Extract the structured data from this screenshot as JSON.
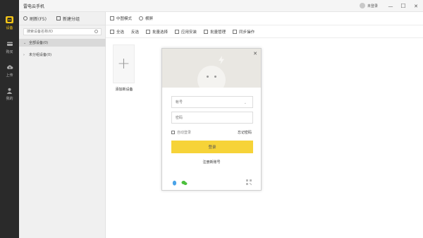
{
  "app": {
    "title": "雷电云手机"
  },
  "account": {
    "status": "未登录"
  },
  "window_controls": {
    "minimize": "—",
    "maximize": "☐",
    "close": "✕"
  },
  "rail": [
    {
      "label": "设备",
      "icon": "device-icon",
      "active": true
    },
    {
      "label": "购买",
      "icon": "cart-icon",
      "active": false
    },
    {
      "label": "上传",
      "icon": "cloud-upload-icon",
      "active": false
    },
    {
      "label": "我的",
      "icon": "user-icon",
      "active": false
    }
  ],
  "groups_toolbar": {
    "refresh": "刷新(F5)",
    "new_group": "新建分组"
  },
  "search": {
    "placeholder": "搜索设备名称/ID"
  },
  "groups": [
    {
      "label": "全部设备(0)",
      "caret": "⌄",
      "selected": true
    },
    {
      "label": "未分组设备(0)",
      "caret": "›",
      "selected": false
    }
  ],
  "view_bar": {
    "mode": "中图模式",
    "orientation": "横屏"
  },
  "action_bar": {
    "select_all": "全选",
    "invert": "反选",
    "batch_select": "批量选择",
    "install_app": "应用安装",
    "batch_manage": "批量管理",
    "sync_ops": "同步操作"
  },
  "add_device": {
    "plus": "+",
    "label": "添加新设备"
  },
  "login_dialog": {
    "close": "✕",
    "account_placeholder": "帐号",
    "password_placeholder": "密码",
    "auto_login": "自动登录",
    "forgot_password": "忘记密码",
    "login_button": "登录",
    "register": "注册新账号"
  },
  "colors": {
    "accent": "#f5c518",
    "button": "#f6d338",
    "rail": "#2a2a2a"
  }
}
